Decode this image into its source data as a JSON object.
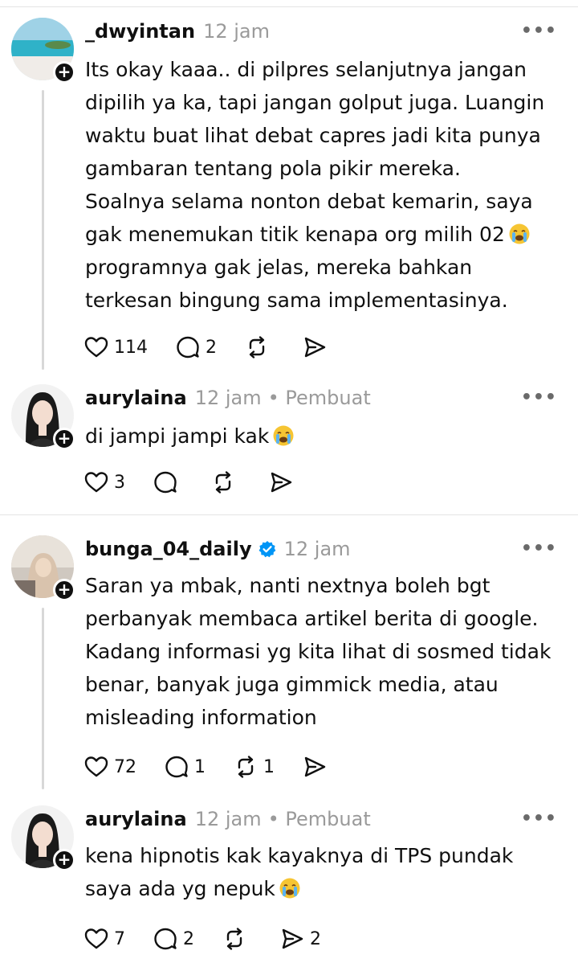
{
  "comments": [
    {
      "username": "_dwyintan",
      "time": "12 jam",
      "creator_tag": "",
      "verified": false,
      "lines": [
        "Its okay kaaa.. di pilpres selanjutnya jangan",
        "dipilih ya ka, tapi jangan golput juga. Luangin",
        "waktu buat lihat debat capres jadi kita punya",
        "gambaran tentang pola pikir mereka.",
        "Soalnya selama nonton debat kemarin, saya",
        "gak menemukan titik kenapa org milih 02",
        "programnya gak jelas, mereka bahkan",
        "terkesan bingung sama implementasinya."
      ],
      "emoji_line": 5,
      "likes": "114",
      "replies": "2",
      "reposts": "",
      "shares": ""
    },
    {
      "username": "aurylaina",
      "time": "12 jam",
      "creator_tag": "• Pembuat",
      "verified": false,
      "lines": [
        "di jampi jampi kak"
      ],
      "emoji_line": 0,
      "likes": "3",
      "replies": "",
      "reposts": "",
      "shares": ""
    },
    {
      "username": "bunga_04_daily",
      "time": "12 jam",
      "creator_tag": "",
      "verified": true,
      "lines": [
        "Saran ya mbak, nanti nextnya boleh bgt",
        "perbanyak membaca artikel berita di google.",
        "Kadang informasi yg kita lihat di sosmed tidak",
        "benar, banyak juga gimmick media, atau",
        "misleading information"
      ],
      "emoji_line": -1,
      "likes": "72",
      "replies": "1",
      "reposts": "1",
      "shares": ""
    },
    {
      "username": "aurylaina",
      "time": "12 jam",
      "creator_tag": "• Pembuat",
      "verified": false,
      "lines": [
        "kena hipnotis kak kayaknya di TPS pundak",
        "saya ada yg nepuk"
      ],
      "emoji_line": 1,
      "likes": "7",
      "replies": "2",
      "reposts": "",
      "shares": "2"
    }
  ],
  "more_label": "•••",
  "follow_label": "+",
  "emoji_name": "loudly-crying-face",
  "colors": {
    "text": "#101010",
    "muted": "#9a9a9a",
    "verified": "#0095f6",
    "divider": "#e4e4e4"
  }
}
